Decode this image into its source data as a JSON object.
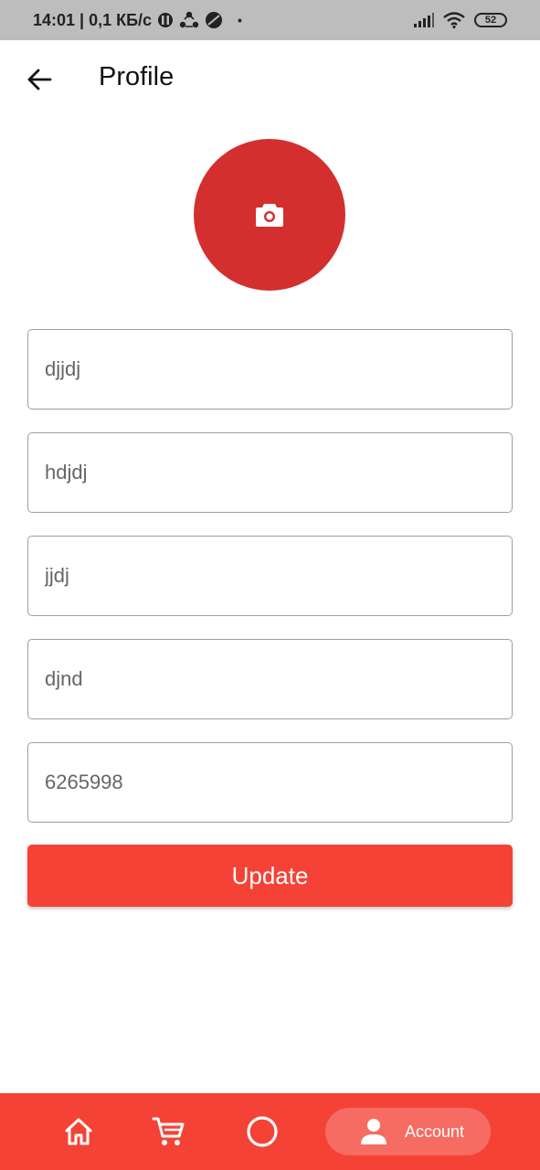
{
  "status_bar": {
    "time_and_speed": "14:01 | 0,1 КБ/с",
    "dot": "•",
    "battery": "52"
  },
  "header": {
    "title": "Profile"
  },
  "form": {
    "fields": [
      {
        "value": "djjdj"
      },
      {
        "value": "hdjdj"
      },
      {
        "value": "jjdj"
      },
      {
        "value": "djnd"
      },
      {
        "value": "6265998"
      }
    ],
    "update_label": "Update"
  },
  "bottom_nav": {
    "items": [
      {
        "icon": "home-icon"
      },
      {
        "icon": "cart-icon"
      },
      {
        "icon": "circle-icon"
      },
      {
        "icon": "person-icon",
        "label": "Account"
      }
    ]
  },
  "colors": {
    "accent": "#f44336",
    "avatar": "#d32f2f",
    "status_bar": "#bdbdbd"
  }
}
